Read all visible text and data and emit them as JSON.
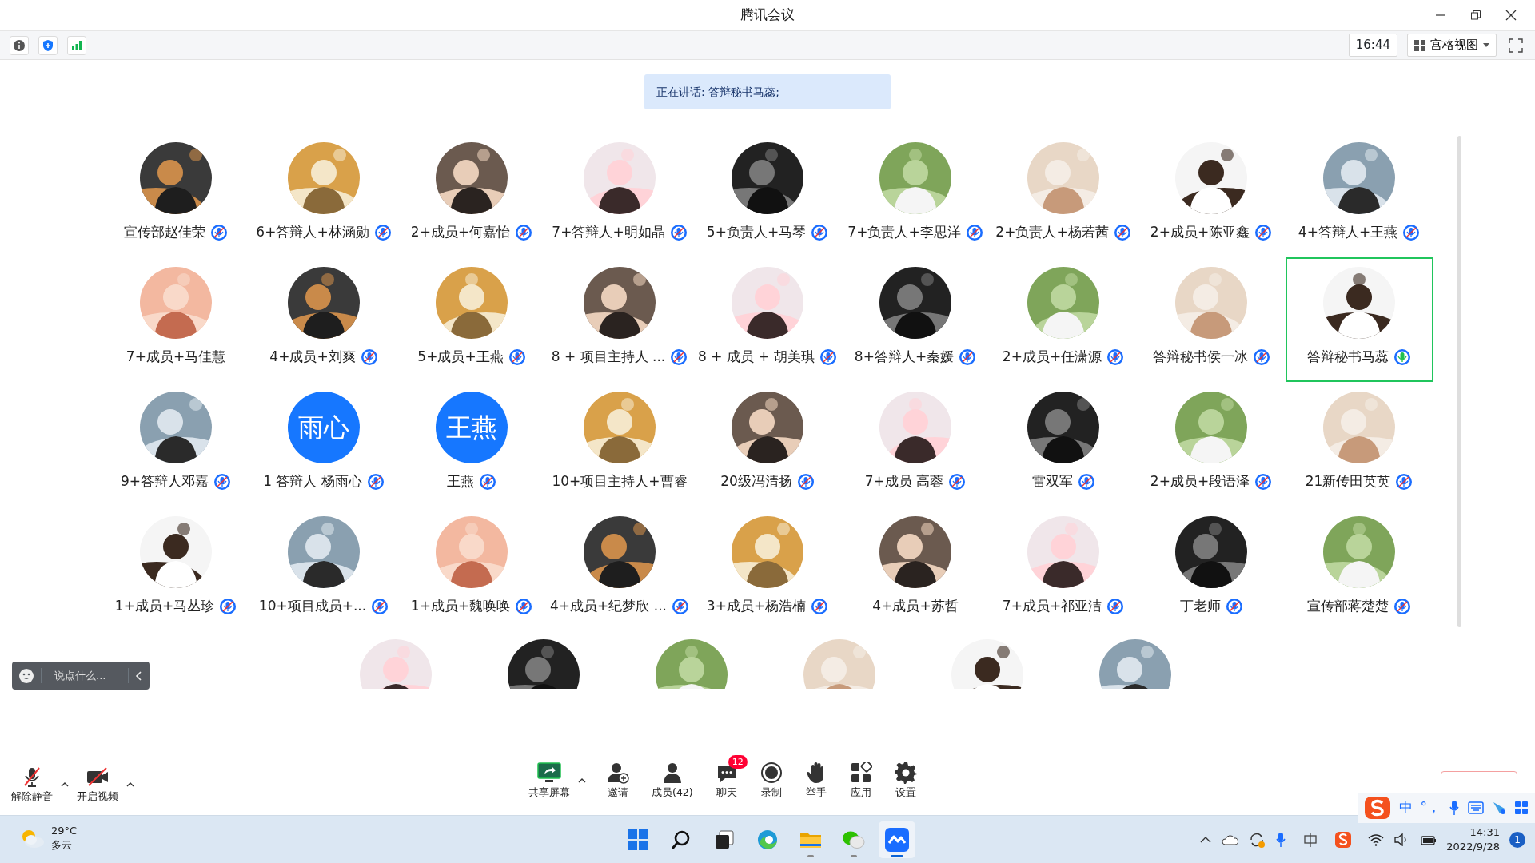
{
  "window": {
    "title": "腾讯会议"
  },
  "toolbar": {
    "time": "16:44",
    "view_label": "宫格视图"
  },
  "speaking_banner": "正在讲话: 答辩秘书马蕊;",
  "participants": [
    {
      "name": "宣传部赵佳荣",
      "mic_shown": true,
      "speaking": false,
      "selected": false
    },
    {
      "name": "6+答辩人+林涵勋",
      "mic_shown": true,
      "speaking": false,
      "selected": false
    },
    {
      "name": "2+成员+何嘉怡",
      "mic_shown": true,
      "speaking": false,
      "selected": false
    },
    {
      "name": "7+答辩人+明如晶",
      "mic_shown": true,
      "speaking": false,
      "selected": false
    },
    {
      "name": "5+负责人+马琴",
      "mic_shown": true,
      "speaking": false,
      "selected": false
    },
    {
      "name": "7+负责人+李思洋",
      "mic_shown": true,
      "speaking": false,
      "selected": false
    },
    {
      "name": "2+负责人+杨若茜",
      "mic_shown": true,
      "speaking": false,
      "selected": false
    },
    {
      "name": "2+成员+陈亚鑫",
      "mic_shown": true,
      "speaking": false,
      "selected": false
    },
    {
      "name": "4+答辩人+王燕",
      "mic_shown": true,
      "speaking": false,
      "selected": false
    },
    {
      "name": "7+成员+马佳慧",
      "mic_shown": false,
      "speaking": false,
      "selected": false
    },
    {
      "name": "4+成员+刘爽",
      "mic_shown": true,
      "speaking": false,
      "selected": false
    },
    {
      "name": "5+成员+王燕",
      "mic_shown": true,
      "speaking": false,
      "selected": false
    },
    {
      "name": "8 + 项目主持人 ...",
      "mic_shown": true,
      "speaking": false,
      "selected": false
    },
    {
      "name": "8 + 成员 + 胡美琪",
      "mic_shown": true,
      "speaking": false,
      "selected": false
    },
    {
      "name": "8+答辩人+秦媛",
      "mic_shown": true,
      "speaking": false,
      "selected": false
    },
    {
      "name": "2+成员+任潇源",
      "mic_shown": true,
      "speaking": false,
      "selected": false
    },
    {
      "name": "答辩秘书侯一冰",
      "mic_shown": true,
      "speaking": false,
      "selected": false
    },
    {
      "name": "答辩秘书马蕊",
      "mic_shown": true,
      "speaking": true,
      "selected": true
    },
    {
      "name": "9+答辩人邓嘉",
      "mic_shown": true,
      "speaking": false,
      "selected": false
    },
    {
      "name": "1 答辩人 杨雨心",
      "avatar": {
        "kind": "text",
        "text": "雨心"
      },
      "mic_shown": true,
      "speaking": false,
      "selected": false
    },
    {
      "name": "王燕",
      "avatar": {
        "kind": "text",
        "text": "王燕"
      },
      "mic_shown": true,
      "speaking": false,
      "selected": false
    },
    {
      "name": "10+项目主持人+曹睿",
      "mic_shown": false,
      "speaking": false,
      "selected": false
    },
    {
      "name": "20级冯清扬",
      "mic_shown": true,
      "speaking": false,
      "selected": false
    },
    {
      "name": "7+成员 高蓉",
      "mic_shown": true,
      "speaking": false,
      "selected": false
    },
    {
      "name": "雷双军",
      "mic_shown": true,
      "speaking": false,
      "selected": false
    },
    {
      "name": "2+成员+段语泽",
      "mic_shown": true,
      "speaking": false,
      "selected": false
    },
    {
      "name": "21新传田英英",
      "mic_shown": true,
      "speaking": false,
      "selected": false
    },
    {
      "name": "1+成员+马丛珍",
      "mic_shown": true,
      "speaking": false,
      "selected": false
    },
    {
      "name": "10+项目成员+...",
      "mic_shown": true,
      "speaking": false,
      "selected": false
    },
    {
      "name": "1+成员+魏唤唤",
      "mic_shown": true,
      "speaking": false,
      "selected": false
    },
    {
      "name": "4+成员+纪梦欣 ...",
      "mic_shown": true,
      "speaking": false,
      "selected": false
    },
    {
      "name": "3+成员+杨浩楠",
      "mic_shown": true,
      "speaking": false,
      "selected": false
    },
    {
      "name": "4+成员+苏哲",
      "mic_shown": false,
      "speaking": false,
      "selected": false
    },
    {
      "name": "7+成员+祁亚洁",
      "mic_shown": true,
      "speaking": false,
      "selected": false
    },
    {
      "name": "丁老师",
      "mic_shown": true,
      "speaking": false,
      "selected": false
    },
    {
      "name": "宣传部蒋楚楚",
      "mic_shown": true,
      "speaking": false,
      "selected": false
    }
  ],
  "chat_prompt": "说点什么...",
  "controls_left": [
    {
      "label": "解除静音",
      "caret": true
    },
    {
      "label": "开启视频",
      "caret": true
    }
  ],
  "controls_center": [
    {
      "label": "共享屏幕",
      "caret": true
    },
    {
      "label": "邀请",
      "caret": false
    },
    {
      "label": "成员(42)",
      "caret": false
    },
    {
      "label": "聊天",
      "caret": false,
      "badge": "12"
    },
    {
      "label": "录制",
      "caret": false
    },
    {
      "label": "举手",
      "caret": false
    },
    {
      "label": "应用",
      "caret": false
    },
    {
      "label": "设置",
      "caret": false
    }
  ],
  "ime": {
    "mode": "中",
    "punct": "°，"
  },
  "taskbar": {
    "weather": {
      "temp": "29°C",
      "desc": "多云"
    },
    "apps": [
      {
        "kind": "start",
        "running": false,
        "active": false
      },
      {
        "kind": "search",
        "running": false,
        "active": false
      },
      {
        "kind": "taskview",
        "running": false,
        "active": false
      },
      {
        "kind": "edge",
        "running": false,
        "active": false
      },
      {
        "kind": "folder",
        "running": true,
        "active": false
      },
      {
        "kind": "wechat",
        "running": true,
        "active": false
      },
      {
        "kind": "meeting",
        "running": true,
        "active": true
      }
    ],
    "time": "14:31",
    "date": "2022/9/28",
    "notifications": "1"
  }
}
